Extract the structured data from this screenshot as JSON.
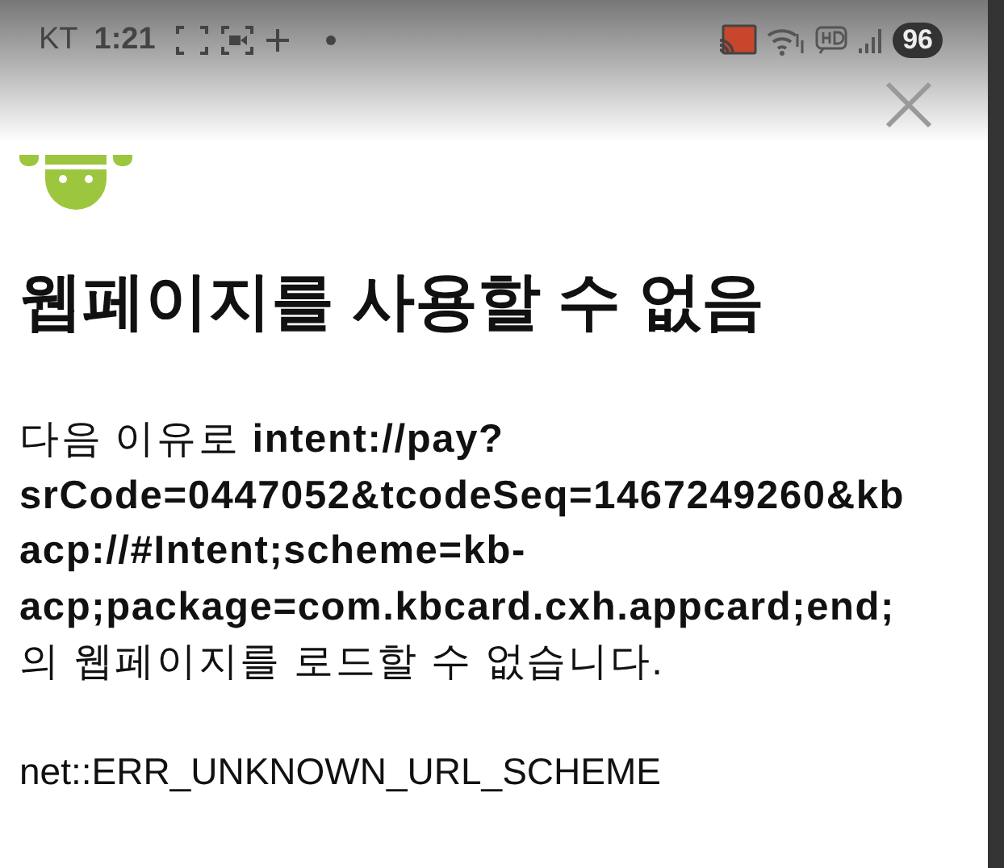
{
  "status_bar": {
    "carrier": "KT",
    "time": "1:21",
    "battery": "96"
  },
  "error_page": {
    "title": "웹페이지를 사용할 수 없음",
    "message": "다음 이유로 **intent://pay?\nsrCode=0447052&tcodeSeq=1467249260&kb\nacp://#Intent;scheme=kb-\nacp;package=com.kbcard.cxh.appcard;end;**\n의 웹페이지를 로드할 수 없습니다.",
    "error_code": "net::ERR_UNKNOWN_URL_SCHEME"
  }
}
